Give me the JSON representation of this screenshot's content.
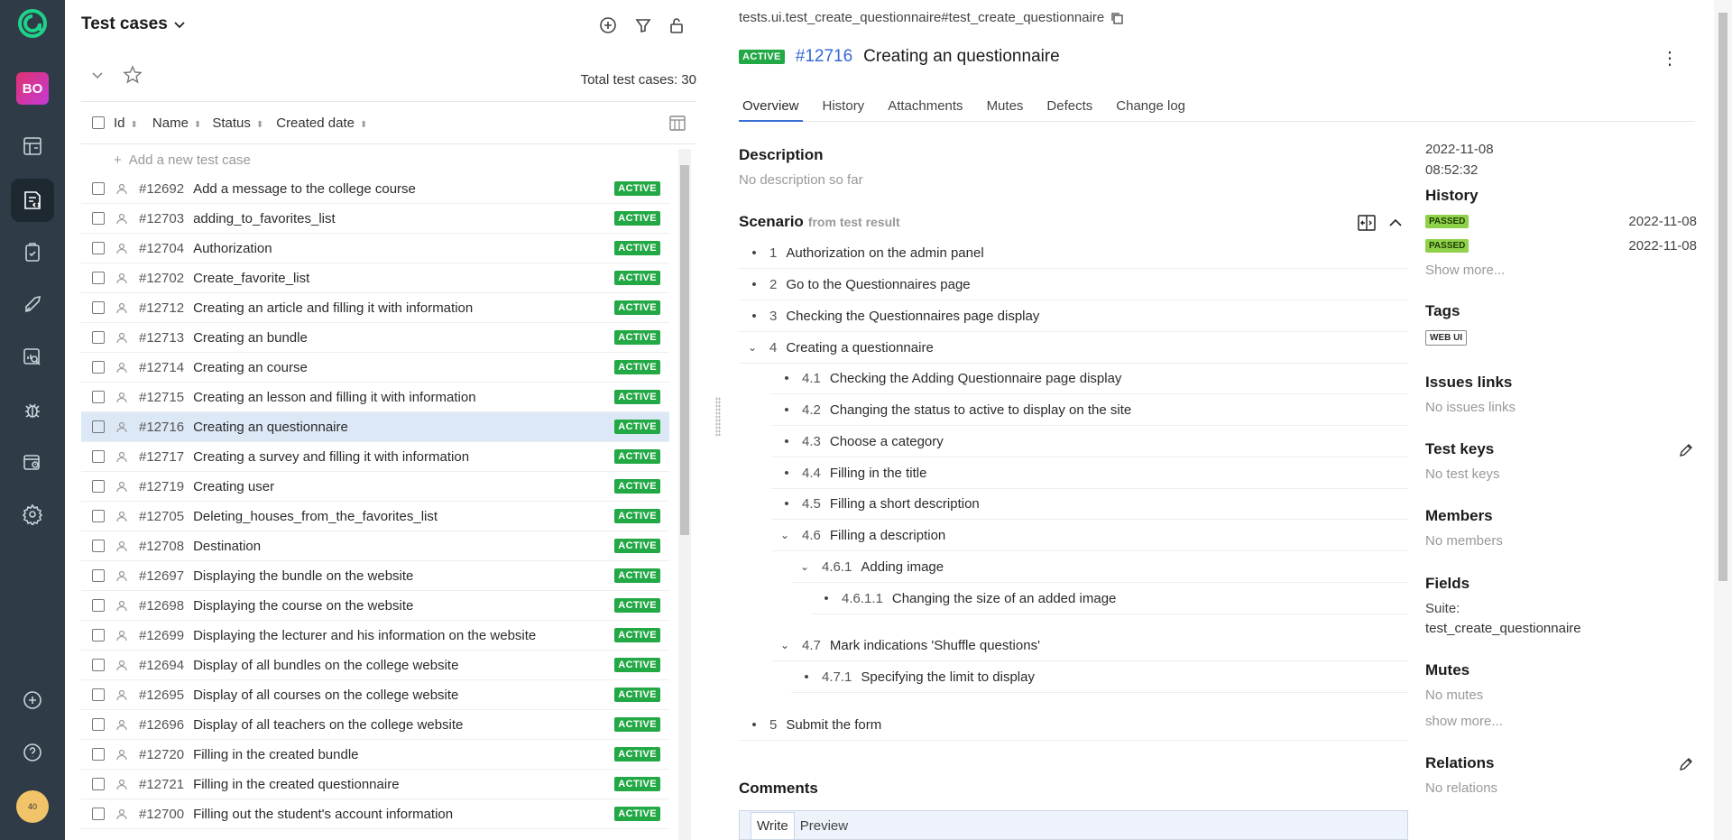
{
  "sidebar": {
    "project_badge": "BO",
    "items": [
      {
        "name": "dashboard",
        "icon": "dashboard-icon"
      },
      {
        "name": "test-cases",
        "icon": "test-cases-icon",
        "active": true
      },
      {
        "name": "test-plans",
        "icon": "clipboard-check-icon"
      },
      {
        "name": "launches",
        "icon": "rocket-icon"
      },
      {
        "name": "analytics",
        "icon": "search-chart-icon"
      },
      {
        "name": "defects",
        "icon": "bug-icon"
      },
      {
        "name": "jobs",
        "icon": "jobs-icon"
      },
      {
        "name": "settings",
        "icon": "gear-icon"
      }
    ],
    "bottom": [
      {
        "icon": "plus-circle-icon"
      },
      {
        "icon": "help-icon"
      }
    ],
    "avatar_label": "40"
  },
  "left": {
    "title": "Test cases",
    "total": "Total test cases: 30",
    "columns": [
      "Id",
      "Name",
      "Status",
      "Created date"
    ],
    "add_placeholder": "Add a new test case",
    "rows": [
      {
        "id": "#12692",
        "name": "Add a message to the college course",
        "status": "ACTIVE"
      },
      {
        "id": "#12703",
        "name": "adding_to_favorites_list",
        "status": "ACTIVE"
      },
      {
        "id": "#12704",
        "name": "Authorization",
        "status": "ACTIVE"
      },
      {
        "id": "#12702",
        "name": "Create_favorite_list",
        "status": "ACTIVE"
      },
      {
        "id": "#12712",
        "name": "Creating an article and filling it with information",
        "status": "ACTIVE"
      },
      {
        "id": "#12713",
        "name": "Creating an bundle",
        "status": "ACTIVE"
      },
      {
        "id": "#12714",
        "name": "Creating an course",
        "status": "ACTIVE"
      },
      {
        "id": "#12715",
        "name": "Creating an lesson and filling it with information",
        "status": "ACTIVE"
      },
      {
        "id": "#12716",
        "name": "Creating an questionnaire",
        "status": "ACTIVE",
        "selected": true
      },
      {
        "id": "#12717",
        "name": "Creating a survey and filling it with information",
        "status": "ACTIVE"
      },
      {
        "id": "#12719",
        "name": "Creating user",
        "status": "ACTIVE"
      },
      {
        "id": "#12705",
        "name": "Deleting_houses_from_the_favorites_list",
        "status": "ACTIVE"
      },
      {
        "id": "#12708",
        "name": "Destination",
        "status": "ACTIVE"
      },
      {
        "id": "#12697",
        "name": "Displaying the bundle on the website",
        "status": "ACTIVE"
      },
      {
        "id": "#12698",
        "name": "Displaying the course on the website",
        "status": "ACTIVE"
      },
      {
        "id": "#12699",
        "name": "Displaying the lecturer and his information on the website",
        "status": "ACTIVE"
      },
      {
        "id": "#12694",
        "name": "Display of all bundles on the college website",
        "status": "ACTIVE"
      },
      {
        "id": "#12695",
        "name": "Display of all courses on the college website",
        "status": "ACTIVE"
      },
      {
        "id": "#12696",
        "name": "Display of all teachers on the college website",
        "status": "ACTIVE"
      },
      {
        "id": "#12720",
        "name": "Filling in the created bundle",
        "status": "ACTIVE"
      },
      {
        "id": "#12721",
        "name": "Filling in the created questionnaire",
        "status": "ACTIVE"
      },
      {
        "id": "#12700",
        "name": "Filling out the student's account information",
        "status": "ACTIVE"
      }
    ]
  },
  "detail": {
    "path": "tests.ui.test_create_questionnaire#test_create_questionnaire",
    "status": "ACTIVE",
    "id": "#12716",
    "title": "Creating an questionnaire",
    "tabs": [
      "Overview",
      "History",
      "Attachments",
      "Mutes",
      "Defects",
      "Change log"
    ],
    "description_title": "Description",
    "description_text": "No description so far",
    "scenario_title": "Scenario",
    "scenario_source": "from test result",
    "steps": [
      {
        "num": "1",
        "text": "Authorization on the admin panel",
        "level": 0
      },
      {
        "num": "2",
        "text": "Go to the Questionnaires page",
        "level": 0
      },
      {
        "num": "3",
        "text": "Checking the Questionnaires page display",
        "level": 0
      },
      {
        "num": "4",
        "text": "Creating a questionnaire",
        "level": 0,
        "expanded": true
      },
      {
        "num": "4.1",
        "text": "Checking the Adding Questionnaire page display",
        "level": 1
      },
      {
        "num": "4.2",
        "text": "Changing the status to active to display on the site",
        "level": 1
      },
      {
        "num": "4.3",
        "text": "Choose a category",
        "level": 1
      },
      {
        "num": "4.4",
        "text": "Filling in the title",
        "level": 1
      },
      {
        "num": "4.5",
        "text": "Filling a short description",
        "level": 1
      },
      {
        "num": "4.6",
        "text": "Filling a description",
        "level": 1,
        "expanded": true
      },
      {
        "num": "4.6.1",
        "text": "Adding image",
        "level": 2,
        "expanded": true
      },
      {
        "num": "4.6.1.1",
        "text": "Changing the size of an added image",
        "level": 3
      },
      {
        "num": "4.7",
        "text": "Mark indications 'Shuffle questions'",
        "level": 1,
        "expanded": true
      },
      {
        "num": "4.7.1",
        "text": "Specifying the limit to display",
        "level": 2
      },
      {
        "num": "5",
        "text": "Submit the form",
        "level": 0
      }
    ],
    "comments_title": "Comments",
    "write_label": "Write",
    "preview_label": "Preview"
  },
  "meta": {
    "created_date": "2022-11-08",
    "created_time": "08:52:32",
    "history_title": "History",
    "history": [
      {
        "status": "PASSED",
        "date": "2022-11-08"
      },
      {
        "status": "PASSED",
        "date": "2022-11-08"
      }
    ],
    "show_more": "Show more...",
    "tags_title": "Tags",
    "tag": "WEB UI",
    "issues_title": "Issues links",
    "issues_text": "No issues links",
    "keys_title": "Test keys",
    "keys_text": "No test keys",
    "members_title": "Members",
    "members_text": "No members",
    "fields_title": "Fields",
    "fields_suite_label": "Suite:",
    "fields_suite_value": "test_create_questionnaire",
    "mutes_title": "Mutes",
    "mutes_text": "No mutes",
    "mutes_more": "show more...",
    "relations_title": "Relations",
    "relations_text": "No relations"
  },
  "colors": {
    "active_badge": "#22a845",
    "passed_badge": "#8fd14b",
    "link": "#3367d6",
    "sidebar": "#2f3b47"
  }
}
